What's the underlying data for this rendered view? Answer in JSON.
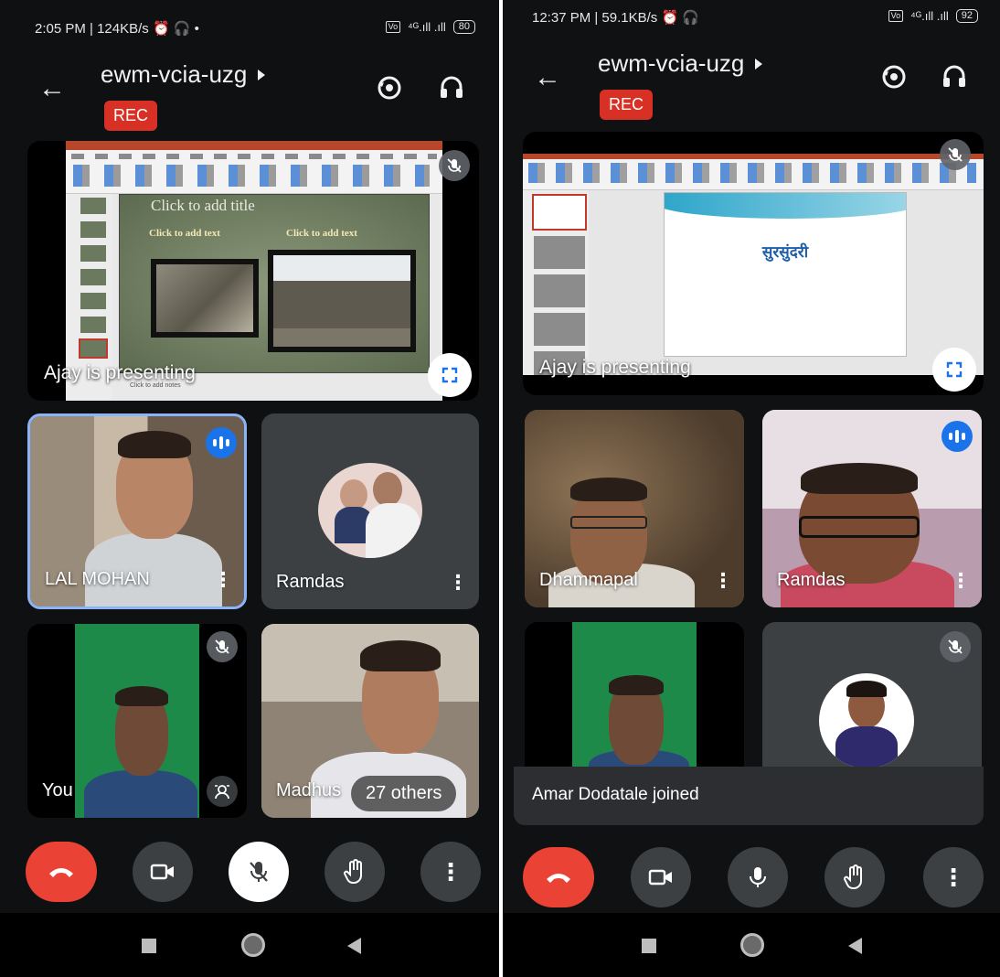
{
  "left": {
    "status": {
      "time": "2:05 PM | 124KB/s",
      "extra": "⏰ 🎧 •",
      "sim": "Vo",
      "signal": "⁴ᴳ.ıll .ıll",
      "battery": "80"
    },
    "meeting_title": "ewm-vcia-uzg",
    "rec_label": "REC",
    "presentation": {
      "presenting_label": "Ajay is presenting",
      "slide_title_placeholder": "Click to add title",
      "slide_text_left": "Click to add text",
      "slide_text_right": "Click to add text",
      "notes_placeholder": "Click to add notes"
    },
    "tiles": [
      {
        "name": "LAL MOHAN"
      },
      {
        "name": "Ramdas"
      },
      {
        "name": "You"
      },
      {
        "name": "Madhus"
      }
    ],
    "others_label": "27 others"
  },
  "right": {
    "status": {
      "time": "12:37 PM | 59.1KB/s",
      "extra": "⏰ 🎧",
      "sim": "Vo",
      "signal": "⁴ᴳ.ıll .ıll",
      "battery": "92"
    },
    "meeting_title": "ewm-vcia-uzg",
    "rec_label": "REC",
    "presentation": {
      "presenting_label": "Ajay is presenting",
      "slide_word": "सुरसुंदरी"
    },
    "tiles": [
      {
        "name": "Dhammapal"
      },
      {
        "name": "Ramdas"
      }
    ],
    "toast": "Amar Dodatale joined"
  },
  "colors": {
    "end_call": "#ea4335",
    "rec": "#d93025",
    "speaking": "#1a73e8",
    "active_border": "#8ab4f8"
  },
  "icons": [
    "back-arrow-icon",
    "flip-camera-icon",
    "headphones-icon",
    "mic-off-icon",
    "fullscreen-icon",
    "hang-up-icon",
    "camera-icon",
    "mic-icon",
    "raise-hand-icon",
    "more-vert-icon",
    "speaking-icon"
  ]
}
